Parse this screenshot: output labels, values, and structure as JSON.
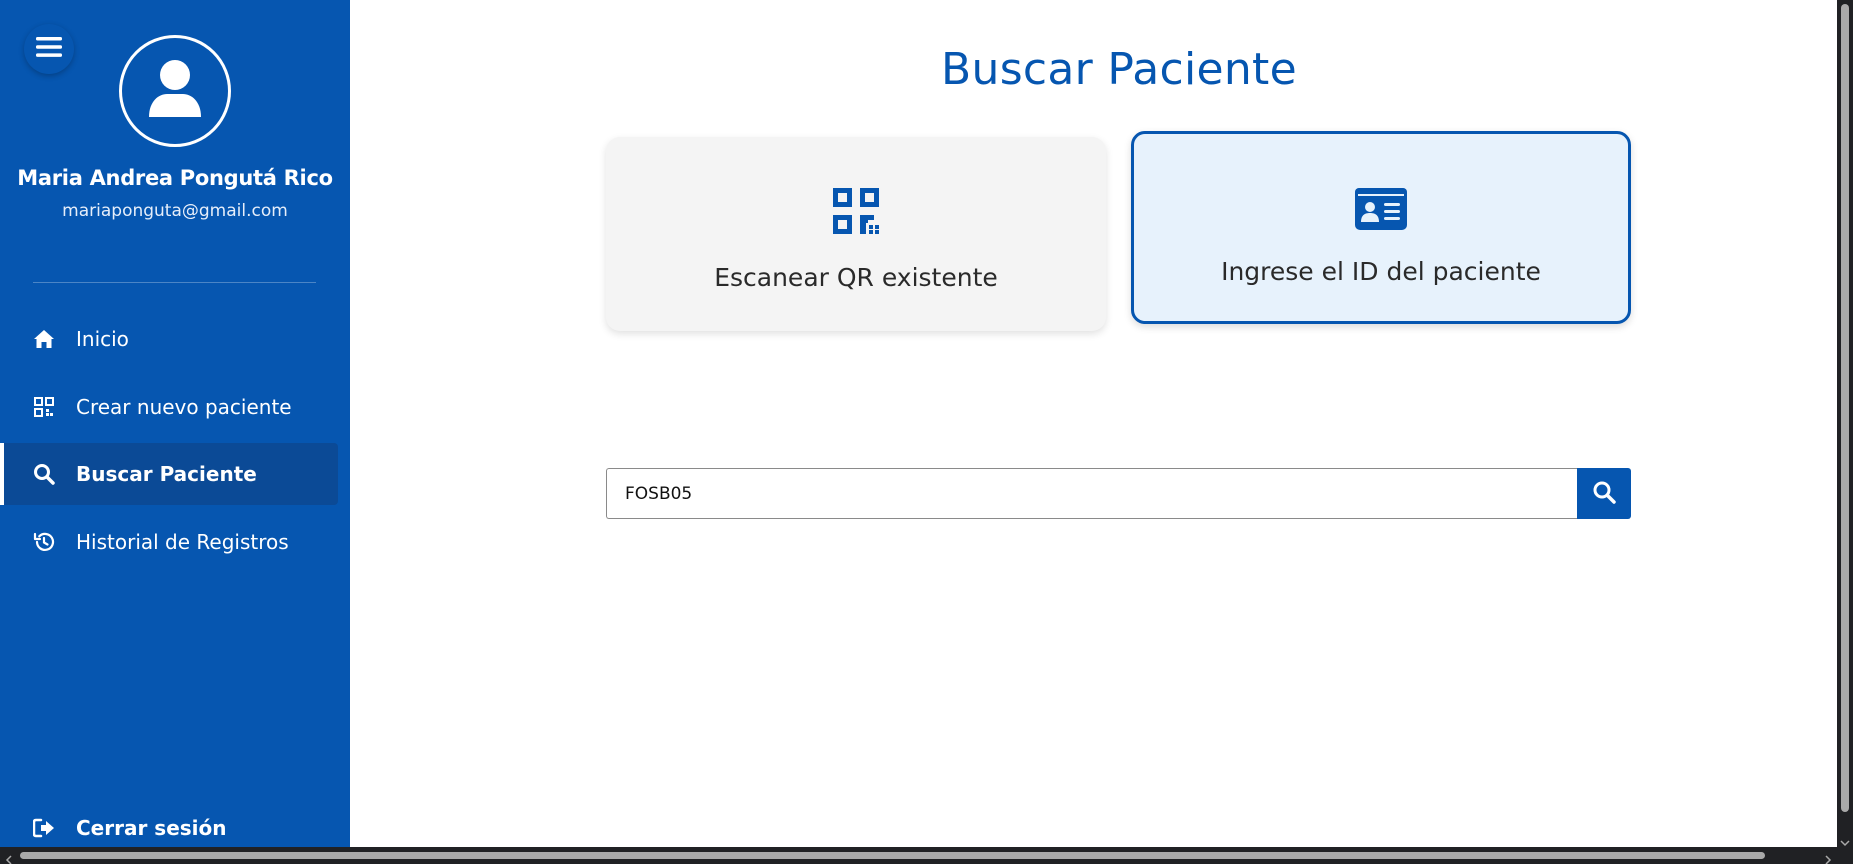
{
  "sidebar": {
    "user": {
      "name": "Maria Andrea Pongutá Rico",
      "email": "mariaponguta@gmail.com"
    },
    "items": [
      {
        "label": "Inicio",
        "icon": "home-icon",
        "active": false
      },
      {
        "label": "Crear nuevo paciente",
        "icon": "qr-code-icon",
        "active": false
      },
      {
        "label": "Buscar Paciente",
        "icon": "search-icon",
        "active": true
      },
      {
        "label": "Historial de Registros",
        "icon": "history-icon",
        "active": false
      }
    ],
    "logout_label": "Cerrar sesión"
  },
  "main": {
    "title": "Buscar Paciente",
    "options": [
      {
        "label": "Escanear QR existente",
        "icon": "qr-code-icon",
        "selected": false
      },
      {
        "label": "Ingrese el ID del paciente",
        "icon": "id-card-icon",
        "selected": true
      }
    ],
    "search": {
      "value": "FOSB05"
    }
  },
  "colors": {
    "primary": "#0656b0",
    "sidebar_active": "#0b4a96",
    "card_selected_bg": "#e7f2fc",
    "card_bg": "#f4f4f4"
  }
}
